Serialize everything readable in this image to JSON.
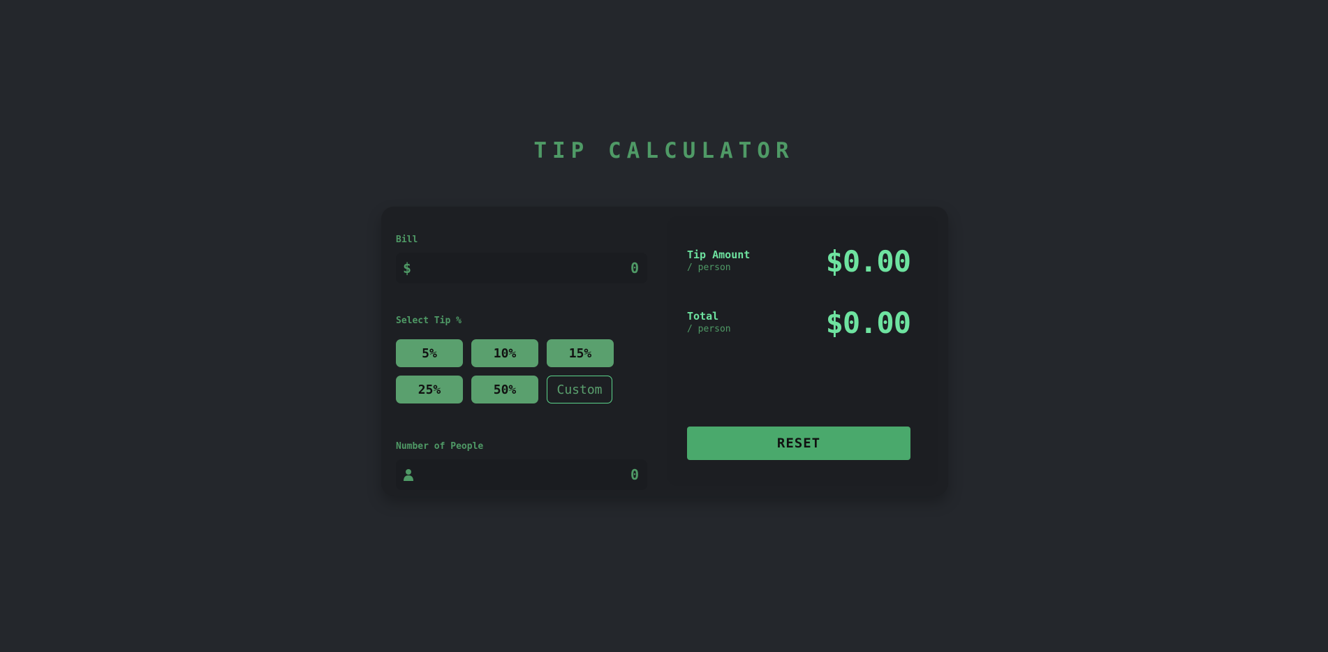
{
  "app": {
    "title": "TIP CALCULATOR"
  },
  "bill": {
    "label": "Bill",
    "currency_symbol": "$",
    "value": "0"
  },
  "tip": {
    "label": "Select Tip %",
    "options": [
      "5%",
      "10%",
      "15%",
      "25%",
      "50%"
    ],
    "custom_label": "Custom"
  },
  "people": {
    "label": "Number of People",
    "icon": "person-icon",
    "value": "0"
  },
  "results": {
    "tip_amount": {
      "label": "Tip Amount",
      "sub": "/ person",
      "value": "$0.00"
    },
    "total": {
      "label": "Total",
      "sub": "/ person",
      "value": "$0.00"
    }
  },
  "reset_label": "RESET",
  "colors": {
    "background": "#24272c",
    "card": "#1d1f23",
    "accent": "#4aa96c",
    "result_text": "#6ee3a0",
    "muted_green": "#4f9a66"
  }
}
